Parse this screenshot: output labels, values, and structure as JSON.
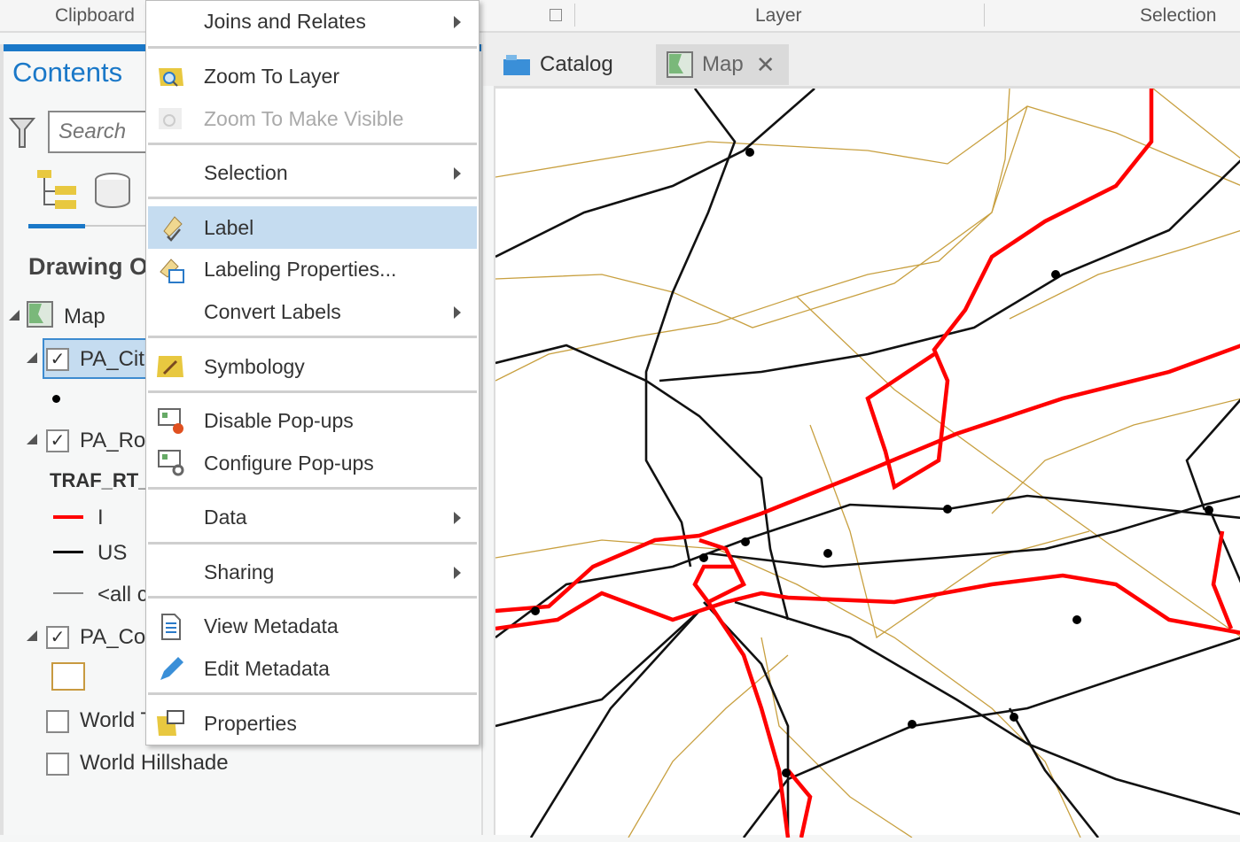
{
  "ribbon": {
    "groups": [
      "Clipboard",
      "Layer",
      "Selection"
    ]
  },
  "contents": {
    "title": "Contents",
    "search_placeholder": "Search",
    "section": "Drawing O",
    "tree": {
      "map": "Map",
      "layer1": "PA_Citi",
      "layer2": "PA_Roa",
      "field": "TRAF_RT_I",
      "legend": [
        {
          "label": "I",
          "color": "#ff0000"
        },
        {
          "label": "US",
          "color": "#000000"
        },
        {
          "label": "<all c",
          "color": "#888888"
        }
      ],
      "layer3": "PA_Cou",
      "layer4": "World T",
      "layer5": "World Hillshade"
    }
  },
  "menu": {
    "items": [
      {
        "label": "Joins and Relates",
        "submenu": true
      },
      {
        "label": "Zoom To Layer",
        "icon": "zoom-to-layer-icon"
      },
      {
        "label": "Zoom To Make Visible",
        "icon": "zoom-visible-icon",
        "disabled": true
      },
      {
        "label": "Selection",
        "submenu": true
      },
      {
        "label": "Label",
        "icon": "label-icon",
        "highlighted": true
      },
      {
        "label": "Labeling Properties...",
        "icon": "labeling-properties-icon"
      },
      {
        "label": "Convert Labels",
        "submenu": true
      },
      {
        "label": "Symbology",
        "icon": "symbology-icon"
      },
      {
        "label": "Disable Pop-ups",
        "icon": "disable-popups-icon"
      },
      {
        "label": "Configure Pop-ups",
        "icon": "configure-popups-icon"
      },
      {
        "label": "Data",
        "submenu": true
      },
      {
        "label": "Sharing",
        "submenu": true
      },
      {
        "label": "View Metadata",
        "icon": "view-metadata-icon"
      },
      {
        "label": "Edit Metadata",
        "icon": "edit-metadata-icon"
      },
      {
        "label": "Properties",
        "icon": "properties-icon"
      }
    ]
  },
  "tabs": {
    "catalog": "Catalog",
    "map": "Map"
  },
  "colors": {
    "accent": "#1a78c8",
    "interstate": "#ff0000",
    "us_route": "#000000",
    "county": "#c8a040",
    "highlight": "#c5dcf0"
  }
}
